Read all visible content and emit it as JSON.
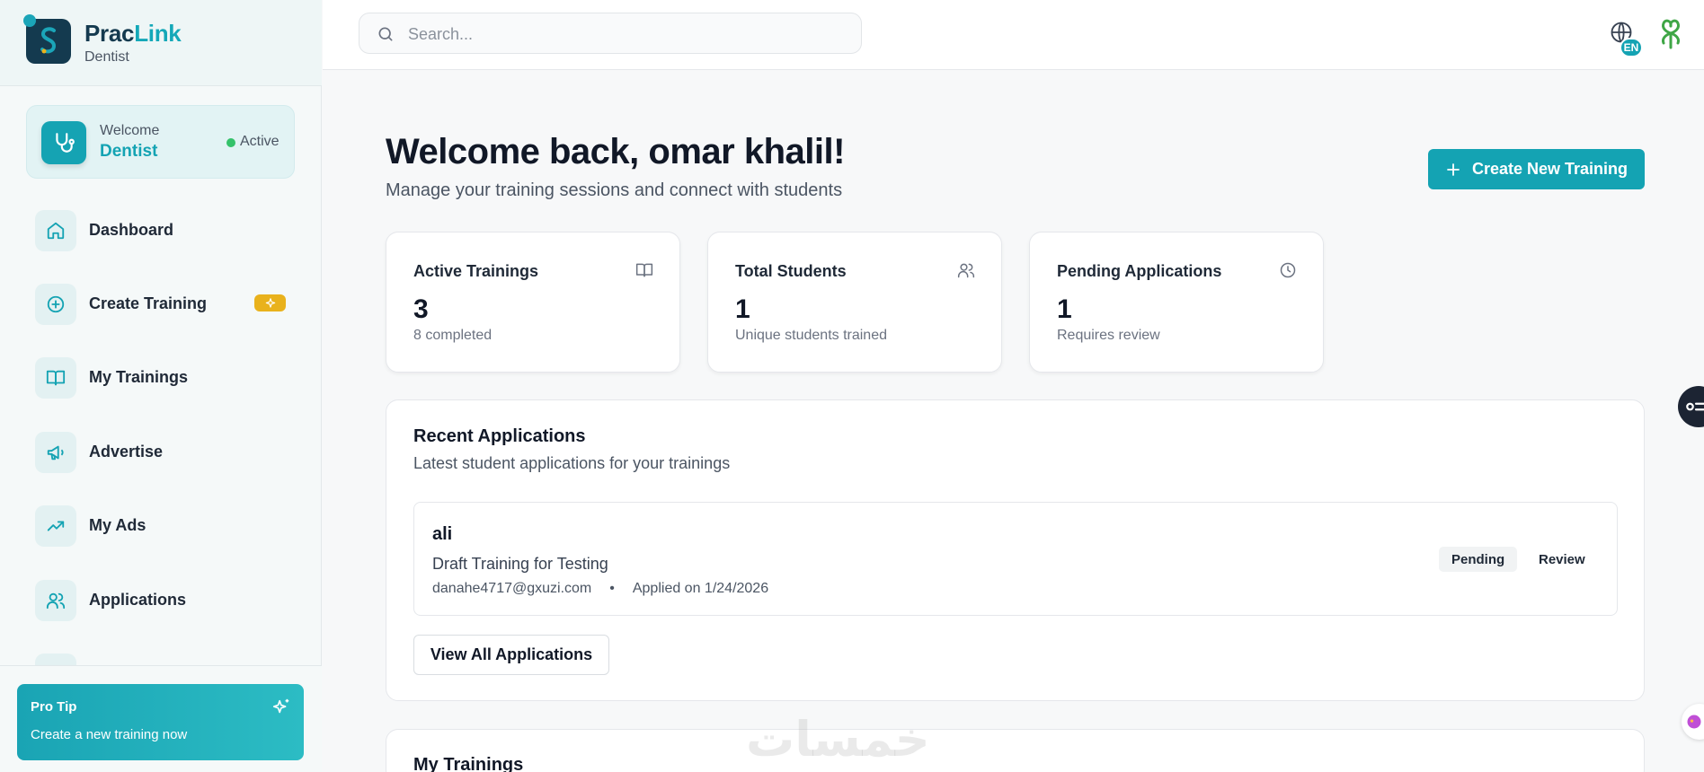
{
  "brand": {
    "name_part1": "Prac",
    "name_part2": "Link",
    "subtitle": "Dentist"
  },
  "welcome": {
    "label": "Welcome",
    "role": "Dentist",
    "status": "Active"
  },
  "nav": [
    {
      "label": "Dashboard",
      "icon": "home-icon"
    },
    {
      "label": "Create Training",
      "icon": "plus-circle-icon",
      "badge_icon": "sparkles-icon"
    },
    {
      "label": "My Trainings",
      "icon": "book-open-icon"
    },
    {
      "label": "Advertise",
      "icon": "megaphone-icon"
    },
    {
      "label": "My Ads",
      "icon": "trending-up-icon"
    },
    {
      "label": "Applications",
      "icon": "users-icon"
    }
  ],
  "pro_tip": {
    "title": "Pro Tip",
    "text": "Create a new training now"
  },
  "search": {
    "placeholder": "Search..."
  },
  "language": {
    "code": "EN"
  },
  "header": {
    "title": "Welcome back, omar khalil!",
    "subtitle": "Manage your training sessions and connect with students",
    "create_button": "Create New Training"
  },
  "stats": [
    {
      "title": "Active Trainings",
      "value": "3",
      "note": "8 completed",
      "icon": "book-open-icon"
    },
    {
      "title": "Total Students",
      "value": "1",
      "note": "Unique students trained",
      "icon": "users-icon"
    },
    {
      "title": "Pending Applications",
      "value": "1",
      "note": "Requires review",
      "icon": "clock-icon"
    }
  ],
  "recent_applications": {
    "title": "Recent Applications",
    "subtitle": "Latest student applications for your trainings",
    "items": [
      {
        "name": "ali",
        "training": "Draft Training for Testing",
        "email": "danahe4717@gxuzi.com",
        "separator": "•",
        "applied": "Applied on 1/24/2026",
        "status": "Pending",
        "action": "Review"
      }
    ],
    "view_all": "View All Applications"
  },
  "my_trainings": {
    "title": "My Trainings"
  },
  "watermark": "خمسات",
  "colors": {
    "accent": "#14a3b3",
    "brand_dark": "#143a4f",
    "badge": "#e9b21c",
    "active": "#34c26a"
  }
}
